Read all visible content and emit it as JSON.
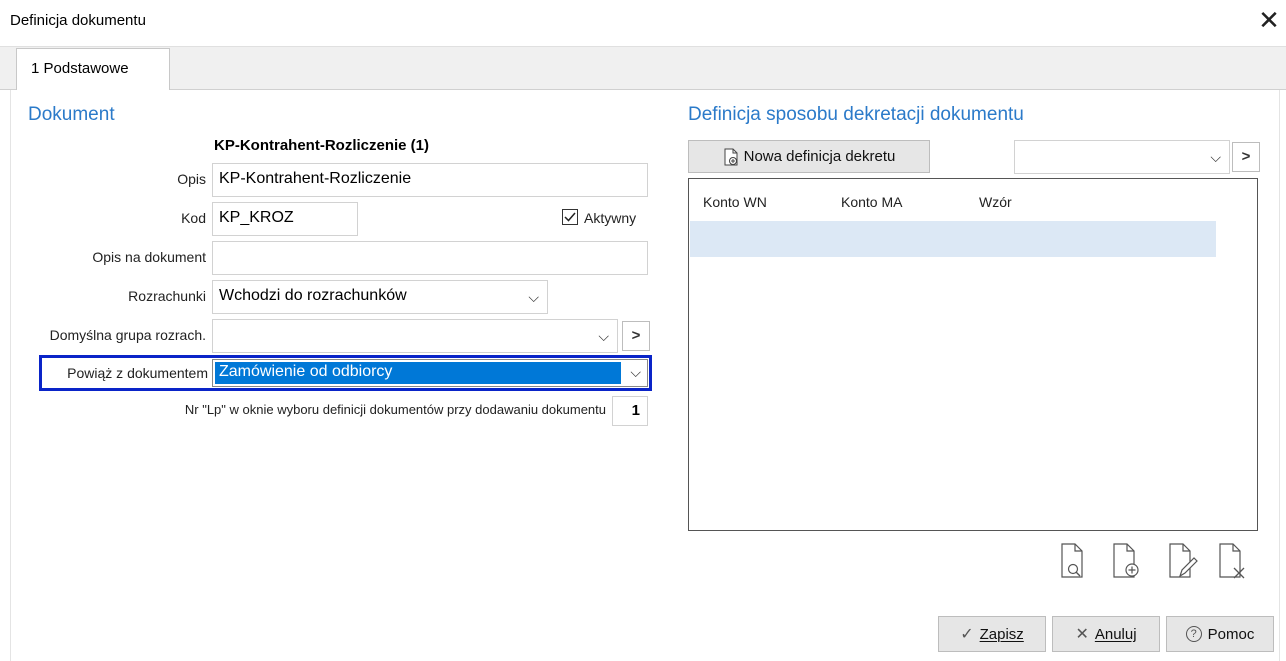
{
  "window": {
    "title": "Definicja dokumentu",
    "close_label": "✕"
  },
  "tabs": [
    {
      "label": "1 Podstawowe"
    }
  ],
  "document": {
    "section_title": "Dokument",
    "header_name": "KP-Kontrahent-Rozliczenie (1)",
    "opis_label": "Opis",
    "opis_value": "KP-Kontrahent-Rozliczenie",
    "kod_label": "Kod",
    "kod_value": "KP_KROZ",
    "aktywny_label": "Aktywny",
    "aktywny_checked": true,
    "opis_na_dok_label": "Opis na dokument",
    "opis_na_dok_value": "",
    "rozrachunki_label": "Rozrachunki",
    "rozrachunki_value": "Wchodzi do rozrachunków",
    "grupa_label": "Domyślna grupa rozrach.",
    "grupa_value": "",
    "powiaz_label": "Powiąż z dokumentem",
    "powiaz_value": "Zamówienie od odbiorcy",
    "lp_label": "Nr \"Lp\" w oknie wyboru definicji dokumentów przy dodawaniu dokumentu",
    "lp_value": "1"
  },
  "dekretacja": {
    "section_title": "Definicja sposobu dekretacji dokumentu",
    "new_button_label": "Nowa definicja dekretu",
    "filter_value": "",
    "columns": [
      "Konto WN",
      "Konto MA",
      "Wzór"
    ],
    "rows": [
      {
        "konto_wn": "",
        "konto_ma": "",
        "wzor": ""
      }
    ]
  },
  "footer": {
    "save_label": "Zapisz",
    "cancel_label": "Anuluj",
    "help_label": "Pomoc"
  },
  "colors": {
    "accent": "#2b7ac9",
    "focus_border": "#0a24c8",
    "selection": "#0078d7",
    "grid_row": "#dce8f5"
  }
}
